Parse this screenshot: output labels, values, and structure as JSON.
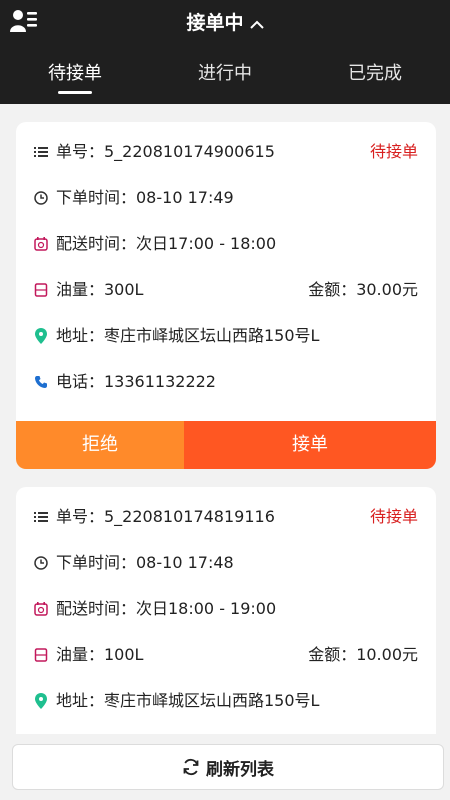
{
  "header": {
    "title": "接单中",
    "title_icon": "chevron-up-icon",
    "profile_icon": "user-list-icon"
  },
  "tabs": [
    {
      "label": "待接单",
      "active": true
    },
    {
      "label": "进行中",
      "active": false
    },
    {
      "label": "已完成",
      "active": false
    }
  ],
  "orders": [
    {
      "order_no": "单号：5_220810174900615",
      "status": "待接单",
      "order_time": "下单时间：08-10 17:49",
      "delivery_time": "配送时间：次日17:00 - 18:00",
      "volume": "油量：300L",
      "amount": "金额：30.00元",
      "address": "地址：枣庄市峄城区坛山西路150号L",
      "phone": "电话：13361132222",
      "reject_label": "拒绝",
      "accept_label": "接单"
    },
    {
      "order_no": "单号：5_220810174819116",
      "status": "待接单",
      "order_time": "下单时间：08-10 17:48",
      "delivery_time": "配送时间：次日18:00 - 19:00",
      "volume": "油量：100L",
      "amount": "金额：10.00元",
      "address": "地址：枣庄市峄城区坛山西路150号L"
    }
  ],
  "footer": {
    "refresh_label": "刷新列表",
    "refresh_icon": "refresh-icon"
  },
  "colors": {
    "header_bg": "#1f1f1f",
    "status": "#d82020",
    "reject": "#ff8a2a",
    "accept": "#ff5722"
  }
}
